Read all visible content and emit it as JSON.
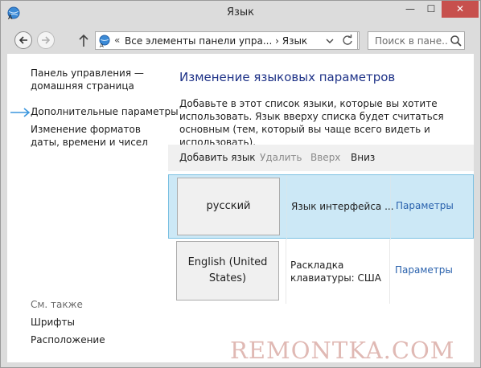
{
  "window": {
    "title": "Язык",
    "minimize_glyph": "—",
    "maximize_glyph": "☐",
    "close_glyph": "✕"
  },
  "address_bar": {
    "separator": "«",
    "path": "Все элементы панели упра...  ›  Язык",
    "search_placeholder": "Поиск в пане..."
  },
  "sidebar": {
    "home_link": "Панель управления — домашняя страница",
    "links": [
      {
        "label": "Дополнительные параметры"
      },
      {
        "label": "Изменение форматов даты, времени и чисел"
      }
    ],
    "see_also_label": "См. также",
    "see_also_links": [
      {
        "label": "Шрифты"
      },
      {
        "label": "Расположение"
      }
    ]
  },
  "main": {
    "heading": "Изменение языковых параметров",
    "description": "Добавьте в этот список языки, которые вы хотите использовать. Язык вверху списка будет считаться основным (тем, который вы чаще всего видеть и использовать).",
    "toolbar": {
      "add": "Добавить язык",
      "remove": "Удалить",
      "up": "Вверх",
      "down": "Вниз"
    },
    "languages": [
      {
        "name": "русский",
        "info": "Язык интерфейса ...",
        "options": "Параметры"
      },
      {
        "name": "English (United States)",
        "info": "Раскладка клавиатуры: США",
        "options": "Параметры"
      }
    ]
  },
  "watermark": "REMONTKA.COM",
  "colors": {
    "accent_link": "#2a62ad",
    "heading": "#1e3287",
    "selection": "#cce8f6",
    "close_button": "#c7504d"
  }
}
